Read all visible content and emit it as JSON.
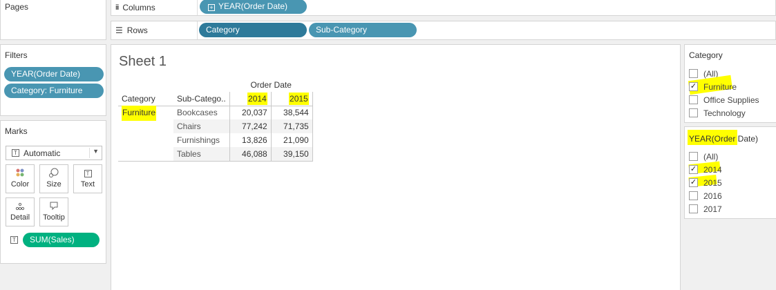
{
  "pages": {
    "title": "Pages"
  },
  "filters": {
    "title": "Filters",
    "items": [
      "YEAR(Order Date)",
      "Category: Furniture"
    ]
  },
  "marks": {
    "title": "Marks",
    "type": "Automatic",
    "buttons": [
      "Color",
      "Size",
      "Text",
      "Detail",
      "Tooltip"
    ],
    "measure": "SUM(Sales)"
  },
  "columns": {
    "label": "Columns",
    "pills": [
      "YEAR(Order Date)"
    ]
  },
  "rows": {
    "label": "Rows",
    "pills": [
      "Category",
      "Sub-Category"
    ]
  },
  "sheet": {
    "title": "Sheet 1",
    "col_header": "Order Date",
    "row_header_1": "Category",
    "row_header_2": "Sub-Catego..",
    "years": [
      "2014",
      "2015"
    ],
    "category": "Furniture",
    "rows": [
      {
        "sub": "Bookcases",
        "v2014": "20,037",
        "v2015": "38,544"
      },
      {
        "sub": "Chairs",
        "v2014": "77,242",
        "v2015": "71,735"
      },
      {
        "sub": "Furnishings",
        "v2014": "13,826",
        "v2015": "21,090"
      },
      {
        "sub": "Tables",
        "v2014": "46,088",
        "v2015": "39,150"
      }
    ]
  },
  "category_filter": {
    "title": "Category",
    "options": [
      "(All)",
      "Furniture",
      "Office Supplies",
      "Technology"
    ],
    "checked": [
      false,
      true,
      false,
      false
    ]
  },
  "year_filter": {
    "title": "YEAR(Order Date)",
    "options": [
      "(All)",
      "2014",
      "2015",
      "2016",
      "2017"
    ],
    "checked": [
      false,
      true,
      true,
      false,
      false
    ]
  },
  "colors": {
    "pill_blue": "#4996b2",
    "pill_dark": "#2e7a9a",
    "pill_green": "#00b180",
    "highlight": "#ffff00"
  }
}
